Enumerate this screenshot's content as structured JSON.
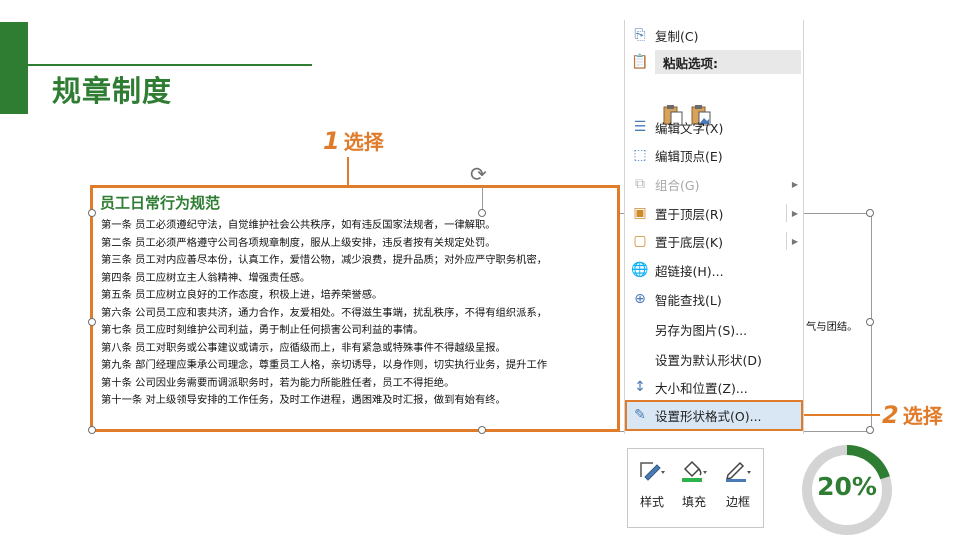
{
  "header": {
    "title": "规章制度"
  },
  "callouts": {
    "first": {
      "number": "1",
      "text": "选择"
    },
    "second": {
      "number": "2",
      "text": "选择"
    }
  },
  "document": {
    "title": "员工日常行为规范",
    "rules": [
      "第一条 员工必须遵纪守法，自觉维护社会公共秩序，如有违反国家法规者，一律解职。",
      "第二条 员工必须严格遵守公司各项规章制度，服从上级安排，违反者按有关规定处罚。",
      "第三条 员工对内应善尽本份，认真工作，爱惜公物，减少浪费，提升品质；对外应严守职务机密，",
      "第四条 员工应树立主人翁精神、增强责任感。",
      "第五条 员工应树立良好的工作态度，积极上进，培养荣誉感。",
      "第六条 公司员工应和衷共济，通力合作，友爱相处。不得滋生事端，扰乱秩序，不得有组织派系，",
      "第七条 员工应时刻维护公司利益，勇于制止任何损害公司利益的事情。",
      "第八条 员工对职务或公事建议或请示，应循级而上，非有紧急或特殊事件不得越级呈报。",
      "第九条 部门经理应秉承公司理念，尊重员工人格，亲切诱导，以身作则，切实执行业务，提升工作",
      "第十条 公司因业务需要而调派职务时，若为能力所能胜任者，员工不得拒绝。",
      "第十一条 对上级领导安排的工作任务，及时工作进程，遇困难及时汇报，做到有始有终。"
    ],
    "overflow_text": "气与团结。"
  },
  "context_menu": {
    "copy": "复制(C)",
    "paste_options": "粘贴选项:",
    "edit_text": "编辑文字(X)",
    "edit_points": "编辑顶点(E)",
    "group": "组合(G)",
    "bring_to_front": "置于顶层(R)",
    "send_to_back": "置于底层(K)",
    "hyperlink": "超链接(H)...",
    "smart_lookup": "智能查找(L)",
    "save_as_picture": "另存为图片(S)...",
    "set_default_shape": "设置为默认形状(D)",
    "size_and_position": "大小和位置(Z)...",
    "format_shape": "设置形状格式(O)..."
  },
  "mini_toolbar": {
    "style": "样式",
    "fill": "填充",
    "outline": "边框"
  },
  "progress": {
    "label": "20%",
    "fraction": 0.2
  },
  "colors": {
    "brand_green": "#2f7d32",
    "accent_orange": "#e07b2a",
    "menu_highlight": "#d9e7f5"
  }
}
